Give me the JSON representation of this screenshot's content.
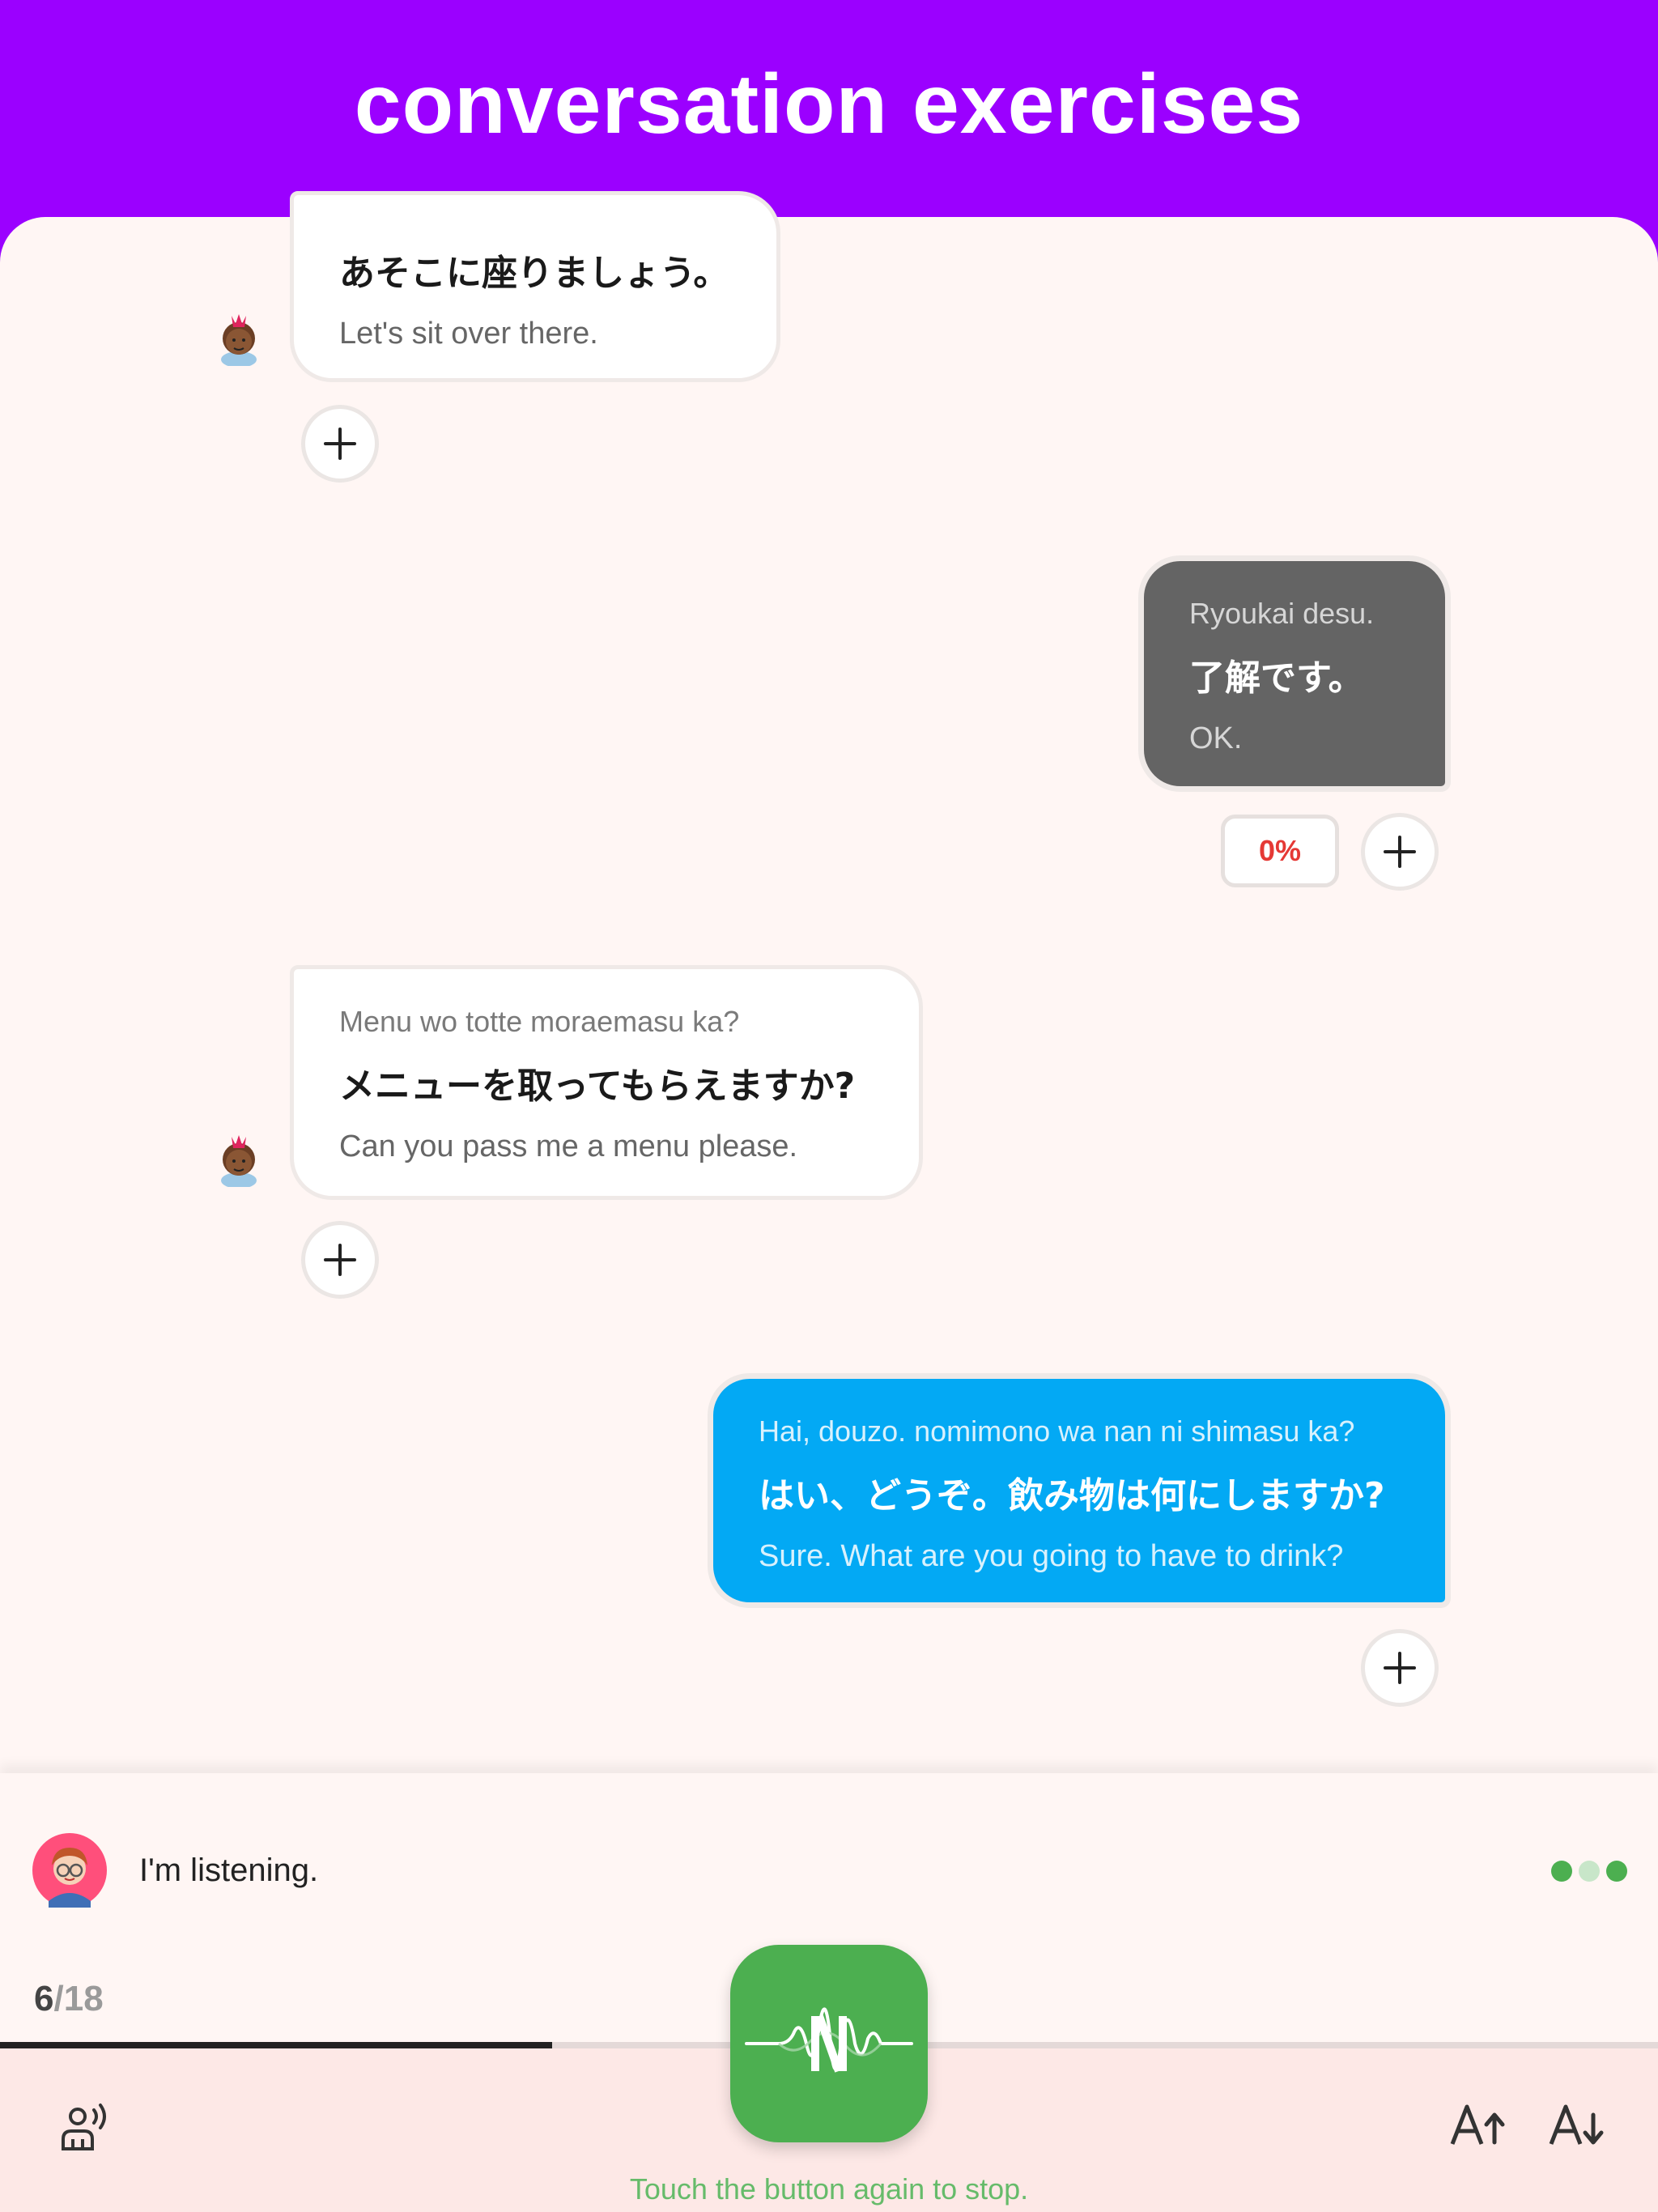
{
  "header": {
    "title": "conversation exercises"
  },
  "conversation": [
    {
      "speaker": "npc",
      "romaji": "",
      "japanese": "あそこに座りましょう。",
      "english": "Let's sit over there."
    },
    {
      "speaker": "user",
      "romaji": "Ryoukai desu.",
      "japanese": "了解です。",
      "english": "OK.",
      "score": "0%"
    },
    {
      "speaker": "npc",
      "romaji": "Menu wo totte moraemasu ka?",
      "japanese": "メニューを取ってもらえますか?",
      "english": "Can you pass me a menu please."
    },
    {
      "speaker": "user",
      "romaji": "Hai, douzo. nomimono wa nan ni shimasu ka?",
      "japanese": "はい、どうぞ。飲み物は何にしますか?",
      "english": "Sure. What are you going to have to drink?"
    }
  ],
  "status": {
    "message": "I'm listening."
  },
  "progress": {
    "current": "6",
    "separator": "/",
    "total": "18",
    "fraction": 0.333
  },
  "record": {
    "hint": "Touch the button again to stop."
  },
  "icons": {
    "add": "plus-icon",
    "speaker": "speaker-voice-icon",
    "font_increase": "font-size-increase-icon",
    "font_decrease": "font-size-decrease-icon",
    "record": "waveform-icon"
  },
  "colors": {
    "header": "#9b00ff",
    "user_bubble_gray": "#646464",
    "user_bubble_blue": "#03a9f4",
    "accent_green": "#4caf50",
    "score_red": "#e53935"
  }
}
